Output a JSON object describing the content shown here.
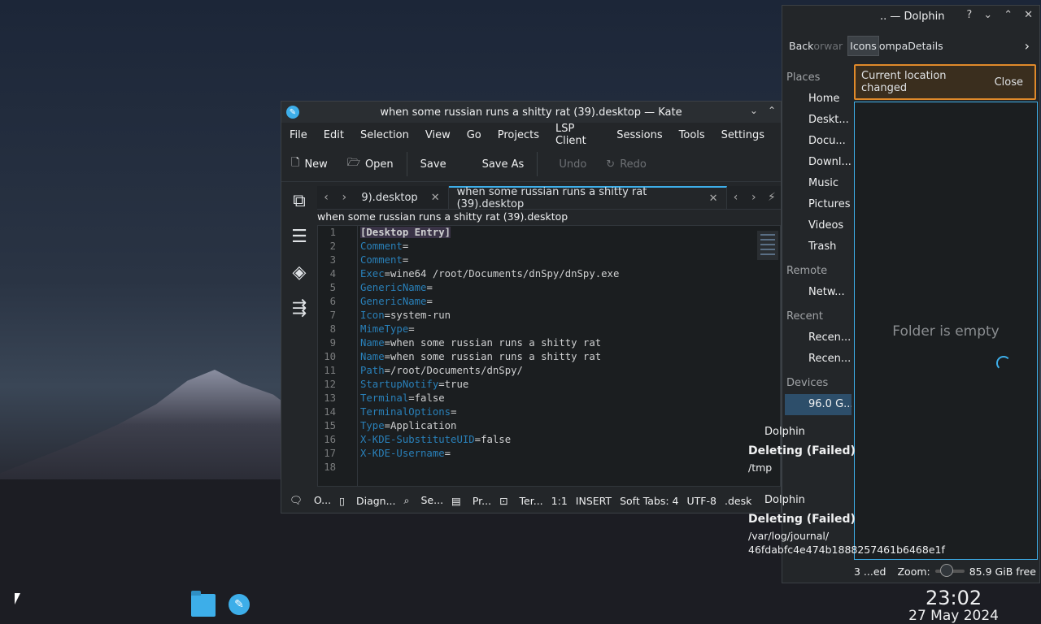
{
  "kate": {
    "title": "when some russian runs a shitty rat (39).desktop — Kate",
    "menu": [
      "File",
      "Edit",
      "Selection",
      "View",
      "Go",
      "Projects",
      "LSP Client",
      "Sessions",
      "Tools",
      "Settings"
    ],
    "toolbar": {
      "new": "New",
      "open": "Open",
      "save": "Save",
      "save_as": "Save As",
      "undo": "Undo",
      "redo": "Redo"
    },
    "tabs": [
      {
        "label": "9).desktop",
        "close": "✕"
      },
      {
        "label": "when some russian runs a shitty rat (39).desktop",
        "close": "✕"
      }
    ],
    "breadcrumb": "when some russian runs a shitty rat (39).desktop",
    "lines": [
      {
        "n": "1",
        "key": "[Desktop Entry]",
        "val": ""
      },
      {
        "n": "2",
        "key": "Comment",
        "val": "="
      },
      {
        "n": "3",
        "key": "Comment",
        "val": "="
      },
      {
        "n": "4",
        "key": "Exec",
        "val": "=wine64 /root/Documents/dnSpy/dnSpy.exe"
      },
      {
        "n": "5",
        "key": "GenericName",
        "val": "="
      },
      {
        "n": "6",
        "key": "GenericName",
        "val": "="
      },
      {
        "n": "7",
        "key": "Icon",
        "val": "=system-run"
      },
      {
        "n": "8",
        "key": "MimeType",
        "val": "="
      },
      {
        "n": "9",
        "key": "Name",
        "val": "=when some russian runs a shitty rat"
      },
      {
        "n": "10",
        "key": "Name",
        "val": "=when some russian runs a shitty rat"
      },
      {
        "n": "11",
        "key": "Path",
        "val": "=/root/Documents/dnSpy/"
      },
      {
        "n": "12",
        "key": "StartupNotify",
        "val": "=true"
      },
      {
        "n": "13",
        "key": "Terminal",
        "val": "=false"
      },
      {
        "n": "14",
        "key": "TerminalOptions",
        "val": "="
      },
      {
        "n": "15",
        "key": "Type",
        "val": "=Application"
      },
      {
        "n": "16",
        "key": "X-KDE-SubstituteUID",
        "val": "=false"
      },
      {
        "n": "17",
        "key": "X-KDE-Username",
        "val": "="
      },
      {
        "n": "18",
        "key": "",
        "val": ""
      }
    ],
    "status": [
      "O...",
      "Diagn...",
      "Se...",
      "Pr...",
      "Ter...",
      "1:1",
      "INSERT",
      "Soft Tabs: 4",
      "UTF-8",
      ".desk"
    ]
  },
  "dolphin": {
    "title": ".. — Dolphin",
    "toolbar": {
      "back": "Back",
      "forward": "orwar",
      "icons": "Icons",
      "compact": "ompa",
      "details": "Details"
    },
    "places_header": "Places",
    "places": [
      "Home",
      "Deskt...",
      "Docu...",
      "Downl...",
      "Music",
      "Pictures",
      "Videos",
      "Trash"
    ],
    "remote_header": "Remote",
    "remote": [
      "Netw..."
    ],
    "recent_header": "Recent",
    "recent": [
      "Recen...",
      "Recen..."
    ],
    "devices_header": "Devices",
    "devices": [
      "96.0 G..."
    ],
    "notice": "Current location changed",
    "notice_close": "Close",
    "empty": "Folder is empty",
    "status_items": "3 ...ed",
    "zoom_label": "Zoom:",
    "free": "85.9 GiB free"
  },
  "notifications": [
    {
      "app": "Dolphin",
      "head": "Deleting (Failed)",
      "body": "/tmp"
    },
    {
      "app": "Dolphin",
      "head": "Deleting (Failed)",
      "body": "/var/log/journal/ 46fdabfc4e474b1888257461b6468e1f"
    }
  ],
  "clock": {
    "time": "23:02",
    "date": "27 May 2024"
  }
}
